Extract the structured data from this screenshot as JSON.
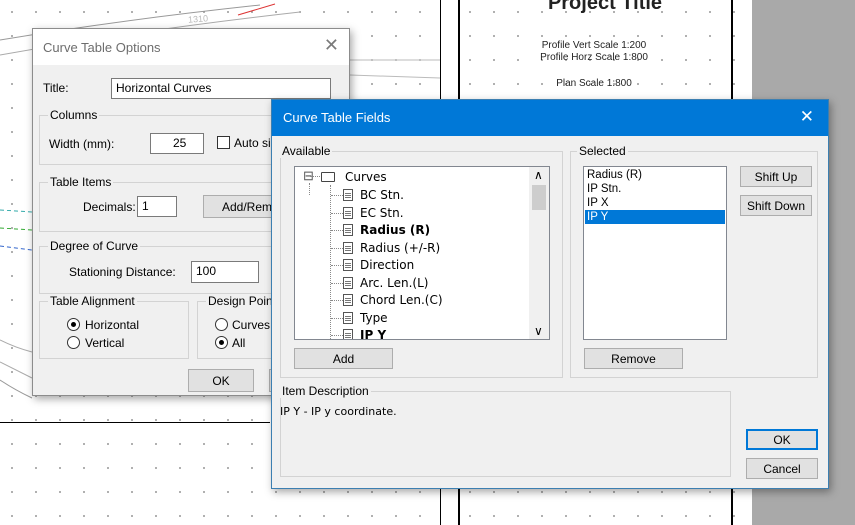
{
  "background": {
    "sheet_title": "Project Title",
    "sheet_lines": [
      "Profile Vert Scale 1:200",
      "Profile Horz Scale 1:800",
      "Plan Scale 1:800"
    ],
    "label_1310": "1310"
  },
  "options_dialog": {
    "title": "Curve Table Options",
    "close_glyph": "✕",
    "title_label": "Title:",
    "title_value": "Horizontal Curves",
    "columns_group": "Columns",
    "width_label": "Width (mm):",
    "width_value": "25",
    "auto_size_label": "Auto siz",
    "table_items_group": "Table Items",
    "decimals_label": "Decimals:",
    "decimals_value": "1",
    "add_remove_button": "Add/Rem",
    "degree_group": "Degree of Curve",
    "stationing_label": "Stationing Distance:",
    "stationing_value": "100",
    "alignment_group": "Table Alignment",
    "horizontal_label": "Horizontal",
    "vertical_label": "Vertical",
    "design_group": "Design Point",
    "curves_label": "Curves",
    "all_label": "All",
    "ok_button": "OK"
  },
  "fields_dialog": {
    "title": "Curve Table Fields",
    "close_glyph": "✕",
    "available_group": "Available",
    "root_toggle": "⊟",
    "root_label": "Curves",
    "available_items": [
      {
        "label": "BC Stn.",
        "bold": false
      },
      {
        "label": "EC Stn.",
        "bold": false
      },
      {
        "label": "Radius (R)",
        "bold": true
      },
      {
        "label": "Radius (+/-R)",
        "bold": false
      },
      {
        "label": "Direction",
        "bold": false
      },
      {
        "label": "Arc. Len.(L)",
        "bold": false
      },
      {
        "label": "Chord Len.(C)",
        "bold": false
      },
      {
        "label": "Type",
        "bold": false
      },
      {
        "label": "IP Y",
        "bold": true
      }
    ],
    "scroll_up": "∧",
    "scroll_down": "∨",
    "add_button": "Add",
    "selected_group": "Selected",
    "selected_items": [
      "Radius (R)",
      "IP Stn.",
      "IP X",
      "IP Y"
    ],
    "selected_active_index": 3,
    "remove_button": "Remove",
    "shift_up_button": "Shift Up",
    "shift_down_button": "Shift Down",
    "description_group": "Item Description",
    "description_text": "IP Y - IP y coordinate.",
    "ok_button": "OK",
    "cancel_button": "Cancel"
  }
}
